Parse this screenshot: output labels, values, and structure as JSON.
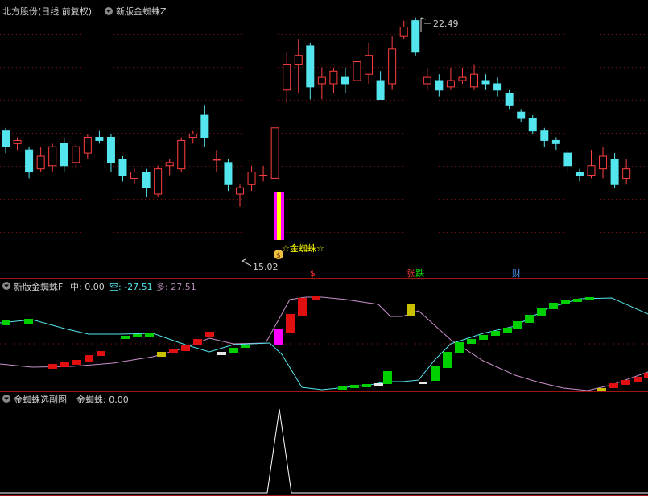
{
  "top_pane": {
    "title": "北方股份(日线 前复权)",
    "indicator": "新版金蜘蛛Z",
    "high_label": "22.49",
    "low_label": "15.02",
    "signal_label": "☆金蜘蛛☆",
    "money_glyph": "$",
    "markers": [
      {
        "text": "$",
        "color": "#ff3030"
      },
      {
        "text": "涨",
        "color": "#ff4040"
      },
      {
        "text": "跌",
        "color": "#00e000"
      },
      {
        "text": "财",
        "color": "#4fa0ff"
      }
    ]
  },
  "mid_pane": {
    "indicator": "新版金蜘蛛F",
    "items": [
      {
        "label": "中: ",
        "value": "0.00",
        "color": "#d0d0d0"
      },
      {
        "label": "空: ",
        "value": "-27.51",
        "color": "#54e6ee"
      },
      {
        "label": "多: ",
        "value": "27.51",
        "color": "#b48cb4"
      }
    ]
  },
  "bottom_pane": {
    "indicator": "金蜘蛛选副图",
    "label": "金蜘蛛: ",
    "value": "0.00"
  },
  "colors": {
    "up": "#ff4040",
    "down": "#54e6ee",
    "grid": "#7a1010",
    "border": "#a01414",
    "magenta": "#ff00ff",
    "yellow": "#ffff00",
    "bull_line": "#54e6ee",
    "bear_line": "#c890c8",
    "green_bar": "#00d000",
    "red_bar": "#e01010",
    "signal_text": "#ffff00"
  },
  "chart_data": {
    "type": "candlestick",
    "candles": [
      {
        "o": 18.9,
        "c": 18.4,
        "h": 19.0,
        "l": 18.2
      },
      {
        "o": 18.5,
        "c": 18.6,
        "h": 18.7,
        "l": 18.3
      },
      {
        "o": 18.3,
        "c": 17.6,
        "h": 18.4,
        "l": 17.4
      },
      {
        "o": 17.7,
        "c": 18.1,
        "h": 18.4,
        "l": 17.6
      },
      {
        "o": 17.8,
        "c": 18.4,
        "h": 18.5,
        "l": 17.6
      },
      {
        "o": 18.5,
        "c": 17.8,
        "h": 18.7,
        "l": 17.6
      },
      {
        "o": 17.9,
        "c": 18.4,
        "h": 18.5,
        "l": 17.7
      },
      {
        "o": 18.2,
        "c": 18.7,
        "h": 18.8,
        "l": 18.0
      },
      {
        "o": 18.7,
        "c": 18.6,
        "h": 18.9,
        "l": 18.5
      },
      {
        "o": 18.7,
        "c": 17.9,
        "h": 18.8,
        "l": 17.6
      },
      {
        "o": 18.0,
        "c": 17.5,
        "h": 18.1,
        "l": 17.3
      },
      {
        "o": 17.4,
        "c": 17.6,
        "h": 17.7,
        "l": 17.2
      },
      {
        "o": 17.6,
        "c": 17.1,
        "h": 17.7,
        "l": 16.8
      },
      {
        "o": 16.9,
        "c": 17.7,
        "h": 17.8,
        "l": 16.8
      },
      {
        "o": 17.8,
        "c": 17.9,
        "h": 18.0,
        "l": 17.5
      },
      {
        "o": 17.7,
        "c": 18.6,
        "h": 18.7,
        "l": 17.6
      },
      {
        "o": 18.7,
        "c": 18.8,
        "h": 18.9,
        "l": 18.5
      },
      {
        "o": 19.4,
        "c": 18.7,
        "h": 19.7,
        "l": 18.4
      },
      {
        "o": 18.0,
        "c": 18.0,
        "h": 18.3,
        "l": 17.6
      },
      {
        "o": 17.9,
        "c": 17.2,
        "h": 18.0,
        "l": 17.0
      },
      {
        "o": 16.9,
        "c": 17.1,
        "h": 17.2,
        "l": 16.5
      },
      {
        "o": 17.2,
        "c": 17.6,
        "h": 17.8,
        "l": 17.0
      },
      {
        "o": 17.5,
        "c": 17.5,
        "h": 17.8,
        "l": 17.3
      },
      {
        "o": 17.4,
        "c": 19.0,
        "h": 19.0,
        "l": 17.4
      },
      {
        "o": 20.2,
        "c": 21.0,
        "h": 21.4,
        "l": 19.8
      },
      {
        "o": 21.0,
        "c": 21.3,
        "h": 21.8,
        "l": 20.1
      },
      {
        "o": 21.6,
        "c": 20.3,
        "h": 21.7,
        "l": 19.9
      },
      {
        "o": 20.4,
        "c": 20.6,
        "h": 20.9,
        "l": 19.9
      },
      {
        "o": 20.4,
        "c": 20.8,
        "h": 20.9,
        "l": 20.1
      },
      {
        "o": 20.6,
        "c": 20.4,
        "h": 20.9,
        "l": 20.1
      },
      {
        "o": 20.5,
        "c": 21.1,
        "h": 21.7,
        "l": 20.4
      },
      {
        "o": 20.7,
        "c": 21.3,
        "h": 21.7,
        "l": 20.4
      },
      {
        "o": 20.5,
        "c": 19.9,
        "h": 20.8,
        "l": 19.9
      },
      {
        "o": 20.4,
        "c": 21.5,
        "h": 21.9,
        "l": 20.2
      },
      {
        "o": 21.9,
        "c": 22.2,
        "h": 22.4,
        "l": 21.8
      },
      {
        "o": 22.4,
        "c": 21.4,
        "h": 22.5,
        "l": 21.3
      },
      {
        "o": 20.4,
        "c": 20.6,
        "h": 20.9,
        "l": 20.2
      },
      {
        "o": 20.5,
        "c": 20.2,
        "h": 20.7,
        "l": 20.0
      },
      {
        "o": 20.3,
        "c": 20.5,
        "h": 20.9,
        "l": 20.2
      },
      {
        "o": 20.5,
        "c": 20.6,
        "h": 20.9,
        "l": 20.4
      },
      {
        "o": 20.3,
        "c": 20.7,
        "h": 21.0,
        "l": 20.2
      },
      {
        "o": 20.5,
        "c": 20.4,
        "h": 20.7,
        "l": 20.2
      },
      {
        "o": 20.4,
        "c": 20.2,
        "h": 20.6,
        "l": 20.0
      },
      {
        "o": 20.1,
        "c": 19.7,
        "h": 20.2,
        "l": 19.6
      },
      {
        "o": 19.5,
        "c": 19.3,
        "h": 19.6,
        "l": 19.2
      },
      {
        "o": 19.3,
        "c": 18.9,
        "h": 19.4,
        "l": 18.8
      },
      {
        "o": 18.9,
        "c": 18.6,
        "h": 19.0,
        "l": 18.4
      },
      {
        "o": 18.6,
        "c": 18.5,
        "h": 18.7,
        "l": 18.3
      },
      {
        "o": 18.2,
        "c": 17.8,
        "h": 18.3,
        "l": 17.6
      },
      {
        "o": 17.6,
        "c": 17.5,
        "h": 17.7,
        "l": 17.3
      },
      {
        "o": 17.5,
        "c": 17.8,
        "h": 18.3,
        "l": 17.4
      },
      {
        "o": 17.7,
        "c": 18.1,
        "h": 18.4,
        "l": 17.4
      },
      {
        "o": 18.0,
        "c": 17.2,
        "h": 18.2,
        "l": 17.1
      },
      {
        "o": 17.4,
        "c": 17.7,
        "h": 18.0,
        "l": 17.2
      }
    ]
  }
}
